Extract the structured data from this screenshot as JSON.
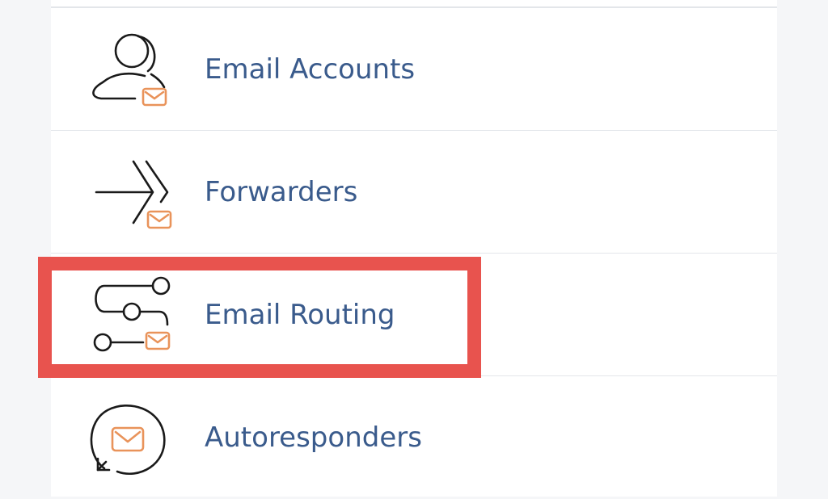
{
  "menu": {
    "items": [
      {
        "label": "Email Accounts",
        "icon": "user-mail-icon"
      },
      {
        "label": "Forwarders",
        "icon": "forward-arrows-mail-icon"
      },
      {
        "label": "Email Routing",
        "icon": "routing-mail-icon"
      },
      {
        "label": "Autoresponders",
        "icon": "cycle-mail-icon"
      }
    ],
    "highlighted_item": "Email Routing"
  },
  "colors": {
    "label": "#3a5b8c",
    "icon_stroke": "#1a1a1a",
    "mail_accent": "#e9935a",
    "highlight": "#e8534e",
    "divider": "#e3e6ea"
  }
}
